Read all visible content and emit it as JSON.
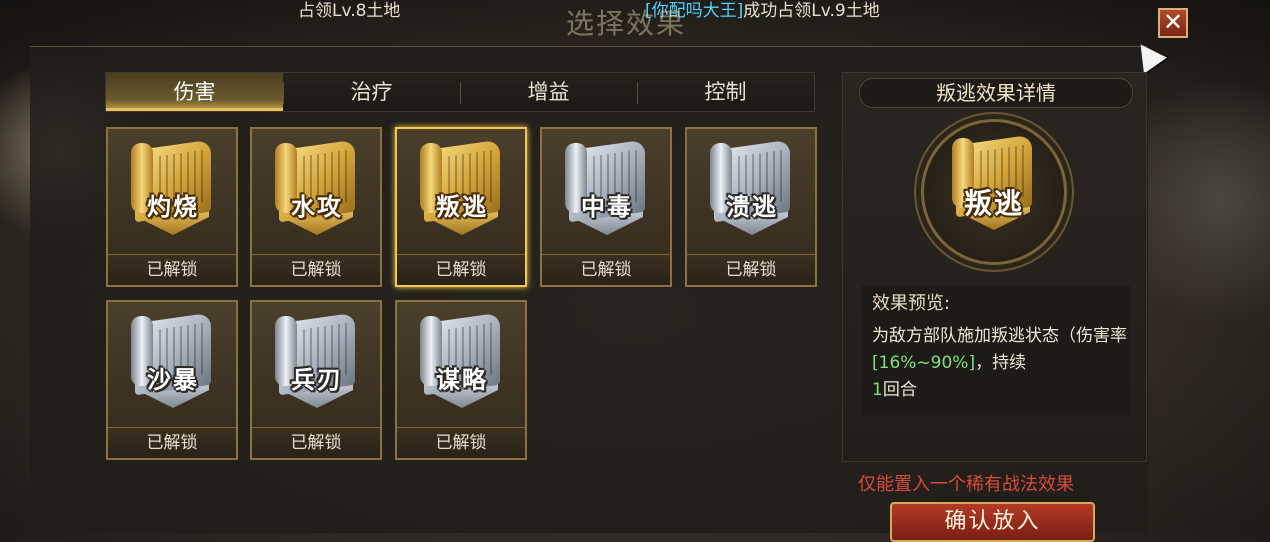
{
  "ticker": {
    "left": "占领Lv.8土地",
    "player": "[你配吗大王]",
    "right": "成功占领Lv.9土地"
  },
  "window_title": "选择效果",
  "tabs": [
    {
      "label": "伤害",
      "active": true
    },
    {
      "label": "治疗",
      "active": false
    },
    {
      "label": "增益",
      "active": false
    },
    {
      "label": "控制",
      "active": false
    }
  ],
  "effects": [
    {
      "name": "灼烧",
      "status": "已解锁",
      "style": "gold"
    },
    {
      "name": "水攻",
      "status": "已解锁",
      "style": "gold"
    },
    {
      "name": "叛逃",
      "status": "已解锁",
      "style": "gold",
      "selected": true
    },
    {
      "name": "中毒",
      "status": "已解锁",
      "style": "silver"
    },
    {
      "name": "溃逃",
      "status": "已解锁",
      "style": "silver"
    },
    {
      "name": "沙暴",
      "status": "已解锁",
      "style": "silver"
    },
    {
      "name": "兵刃",
      "status": "已解锁",
      "style": "silver"
    },
    {
      "name": "谋略",
      "status": "已解锁",
      "style": "silver"
    }
  ],
  "detail": {
    "title": "叛逃效果详情",
    "effect_name": "叛逃",
    "preview_heading": "效果预览:",
    "desc_part1": "为敌方部队施加叛逃状态（伤害率",
    "desc_rate": "[16%~90%]",
    "desc_part2": "，持续",
    "desc_turns": "1",
    "desc_part3": "回合"
  },
  "warning": "仅能置入一个稀有战法效果",
  "confirm_label": "确认放入",
  "close_label": "✕",
  "colors": {
    "tab_active": "#c7a34a",
    "selected_border": "#f2c94c",
    "warning": "#d94a3a",
    "highlight_green": "#7ee37a",
    "player_name": "#4fd3ff"
  }
}
